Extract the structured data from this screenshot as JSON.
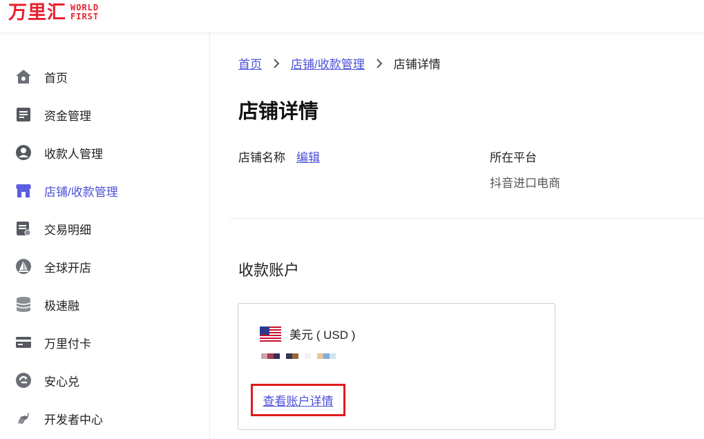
{
  "header": {
    "logo_cn": "万里汇",
    "logo_en_line1": "WORLD",
    "logo_en_line2": "FIRST"
  },
  "sidebar": {
    "items": [
      {
        "label": "首页",
        "icon": "home-icon"
      },
      {
        "label": "资金管理",
        "icon": "document-icon"
      },
      {
        "label": "收款人管理",
        "icon": "user-icon"
      },
      {
        "label": "店铺/收款管理",
        "icon": "store-icon",
        "active": true
      },
      {
        "label": "交易明细",
        "icon": "receipt-icon"
      },
      {
        "label": "全球开店",
        "icon": "sailboat-icon"
      },
      {
        "label": "极速融",
        "icon": "database-icon"
      },
      {
        "label": "万里付卡",
        "icon": "card-icon"
      },
      {
        "label": "安心兑",
        "icon": "exchange-icon"
      },
      {
        "label": "开发者中心",
        "icon": "developer-icon"
      }
    ],
    "active_color": "#4a4fd8"
  },
  "breadcrumb": {
    "home": "首页",
    "parent": "店铺/收款管理",
    "current": "店铺详情"
  },
  "page": {
    "title": "店铺详情",
    "store_name_label": "店铺名称",
    "edit_label": "编辑",
    "store_name_value": "",
    "platform_label": "所在平台",
    "platform_value": "抖音进口电商"
  },
  "accounts": {
    "section_title": "收款账户",
    "currency": "美元 ( USD )",
    "details_link": "查看账户详情"
  },
  "colors": {
    "brand_red": "#e8202e",
    "link_blue": "#4a4fd8",
    "highlight_red": "#e01a1a"
  }
}
